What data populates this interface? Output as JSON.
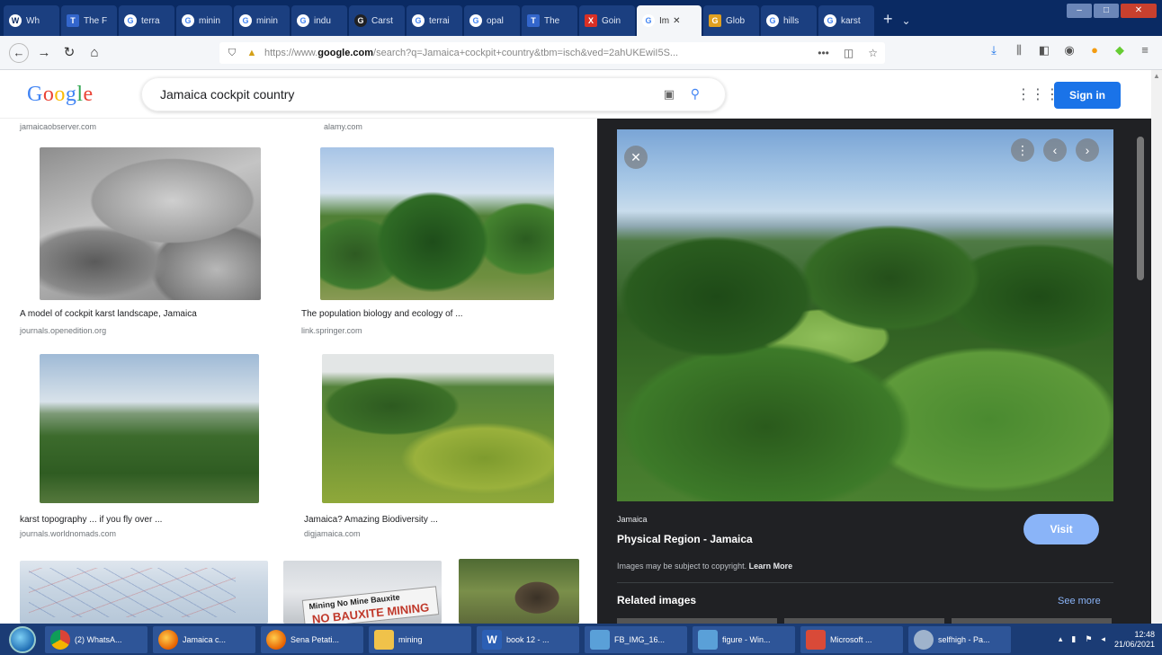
{
  "browser": {
    "tabs": [
      {
        "label": "Wh",
        "fav": "whatsapp-icon",
        "favtext": "W"
      },
      {
        "label": "The F",
        "fav": "tab-favicon",
        "favtext": "T"
      },
      {
        "label": "terra",
        "fav": "google-icon",
        "favtext": "G"
      },
      {
        "label": "minin",
        "fav": "google-icon",
        "favtext": "G"
      },
      {
        "label": "minin",
        "fav": "google-icon",
        "favtext": "G"
      },
      {
        "label": "indu",
        "fav": "google-icon",
        "favtext": "G"
      },
      {
        "label": "Carst",
        "fav": "google-icon",
        "favtext": "G"
      },
      {
        "label": "terrai",
        "fav": "google-icon",
        "favtext": "G"
      },
      {
        "label": "opal",
        "fav": "google-icon",
        "favtext": "G"
      },
      {
        "label": "The",
        "fav": "tab-favicon",
        "favtext": "T"
      },
      {
        "label": "Goin",
        "fav": "tab-favicon",
        "favtext": "X"
      },
      {
        "label": "Im",
        "fav": "google-icon",
        "favtext": "G",
        "active": true
      },
      {
        "label": "Glob",
        "fav": "tab-favicon",
        "favtext": "G"
      },
      {
        "label": "hills",
        "fav": "google-icon",
        "favtext": "G"
      },
      {
        "label": "karst",
        "fav": "google-icon",
        "favtext": "G"
      }
    ],
    "url_prefix": "https://www.",
    "url_domain": "google.com",
    "url_rest": "/search?q=Jamaica+cockpit+country&tbm=isch&ved=2ahUKEwiI5S..."
  },
  "google": {
    "logo_letters": [
      "G",
      "o",
      "o",
      "g",
      "l",
      "e"
    ],
    "query": "Jamaica cockpit country",
    "signin_label": "Sign in"
  },
  "results": {
    "top_captions": [
      "jamaicaobserver.com",
      "alamy.com"
    ],
    "items": [
      {
        "caption": "A model of cockpit karst landscape, Jamaica",
        "source": "journals.openedition.org"
      },
      {
        "caption": "The population biology and ecology of ...",
        "source": "link.springer.com"
      },
      {
        "caption": "karst topography ... if you fly over ...",
        "source": "journals.worldnomads.com"
      },
      {
        "caption": "Jamaica? Amazing Biodiversity ...",
        "source": "digjamaica.com"
      }
    ],
    "banner_line1": "Mining No Mine Bauxite",
    "banner_line2": "NO BAUXITE MINING"
  },
  "preview": {
    "domain": "Jamaica",
    "title": "Physical Region - Jamaica",
    "copyright_text": "Images may be subject to copyright.",
    "learn_more": "Learn More",
    "visit_label": "Visit",
    "related_label": "Related images",
    "see_more_label": "See more"
  },
  "taskbar": {
    "items": [
      {
        "label": "(2) WhatsA...",
        "icon": "chrome"
      },
      {
        "label": "Jamaica c...",
        "icon": "ff"
      },
      {
        "label": "Sena Petati...",
        "icon": "ff"
      },
      {
        "label": "mining",
        "icon": "folder"
      },
      {
        "label": "book 12 - ...",
        "icon": "word"
      },
      {
        "label": "FB_IMG_16...",
        "icon": "photo"
      },
      {
        "label": "figure - Win...",
        "icon": "photo"
      },
      {
        "label": "Microsoft ...",
        "icon": "ms"
      },
      {
        "label": "selfhigh - Pa...",
        "icon": "gear"
      }
    ],
    "time": "12:48",
    "date": "21/06/2021"
  }
}
